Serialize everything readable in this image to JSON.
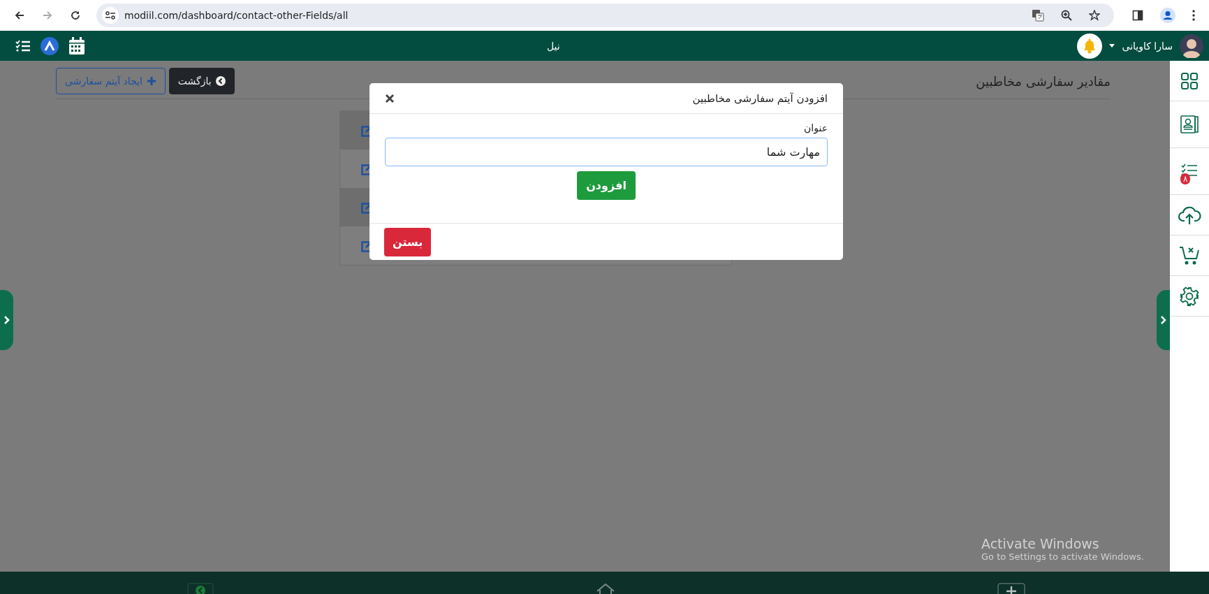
{
  "browser": {
    "url": "modiil.com/dashboard/contact-other-Fields/all"
  },
  "header": {
    "brand": "نیل",
    "user_name": "سارا کاویانی"
  },
  "page": {
    "title": "مقادیر سفارشی مخاطبین",
    "buttons": [
      {
        "kind": "back",
        "label": "بازگشت"
      },
      {
        "kind": "create",
        "label": "ایجاد آیتم سفارشی"
      }
    ]
  },
  "table": {
    "rows": [
      {
        "kind": "edit"
      },
      {
        "kind": "edit"
      },
      {
        "kind": "edit"
      },
      {
        "kind": "edit"
      }
    ]
  },
  "sidebar": {
    "items": [
      {
        "kind": "apps"
      },
      {
        "kind": "contacts"
      },
      {
        "kind": "tasks",
        "badge": "۸"
      },
      {
        "kind": "upload"
      },
      {
        "kind": "cart"
      },
      {
        "kind": "settings"
      }
    ]
  },
  "modal": {
    "title": "افزودن آیتم سفارشی مخاطبین",
    "field_label": "عنوان",
    "field_value": "مهارت شما",
    "submit": "افزودن",
    "close": "بستن"
  },
  "os_notice": {
    "title": "Activate Windows",
    "subtitle": "Go to Settings to activate Windows."
  }
}
